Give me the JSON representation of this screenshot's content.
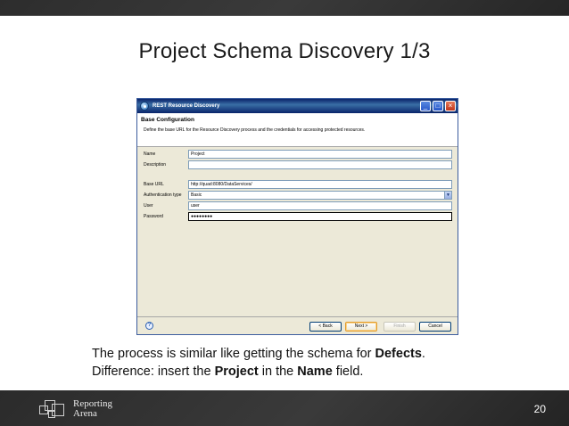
{
  "slide": {
    "title": "Project Schema Discovery 1/3",
    "page_number": "20"
  },
  "dialog": {
    "window_title": "REST Resource Discovery",
    "section_title": "Base Configuration",
    "description": "Define the base URL for the Resource Discovery process and the credentials for accessing protected resources.",
    "fields": {
      "name": {
        "label": "Name",
        "value": "Project"
      },
      "description": {
        "label": "Description",
        "value": ""
      },
      "base_url": {
        "label": "Base URL",
        "value": "http://quad:8080/DataServices/"
      },
      "auth_type": {
        "label": "Authentication type",
        "value": "Basic"
      },
      "user": {
        "label": "User",
        "value": "user"
      },
      "password": {
        "label": "Password",
        "value": "●●●●●●●●"
      }
    },
    "buttons": {
      "back": "< Back",
      "next": "Next >",
      "finish": "Finish",
      "cancel": "Cancel"
    },
    "help_symbol": "?"
  },
  "caption": {
    "line1_prefix": "The process is similar like getting the schema for ",
    "line1_bold": "Defects",
    "line1_suffix": ".",
    "line2_prefix": "Difference: insert the ",
    "line2_bold1": "Project",
    "line2_middle": " in the ",
    "line2_bold2": "Name",
    "line2_suffix": " field."
  },
  "branding": {
    "logo_line1": "Reporting",
    "logo_line2": "Arena"
  },
  "colors": {
    "titlebar": "#0a246a",
    "dialog_bg": "#ece9d8",
    "footer_bar": "#2f2f2f"
  }
}
